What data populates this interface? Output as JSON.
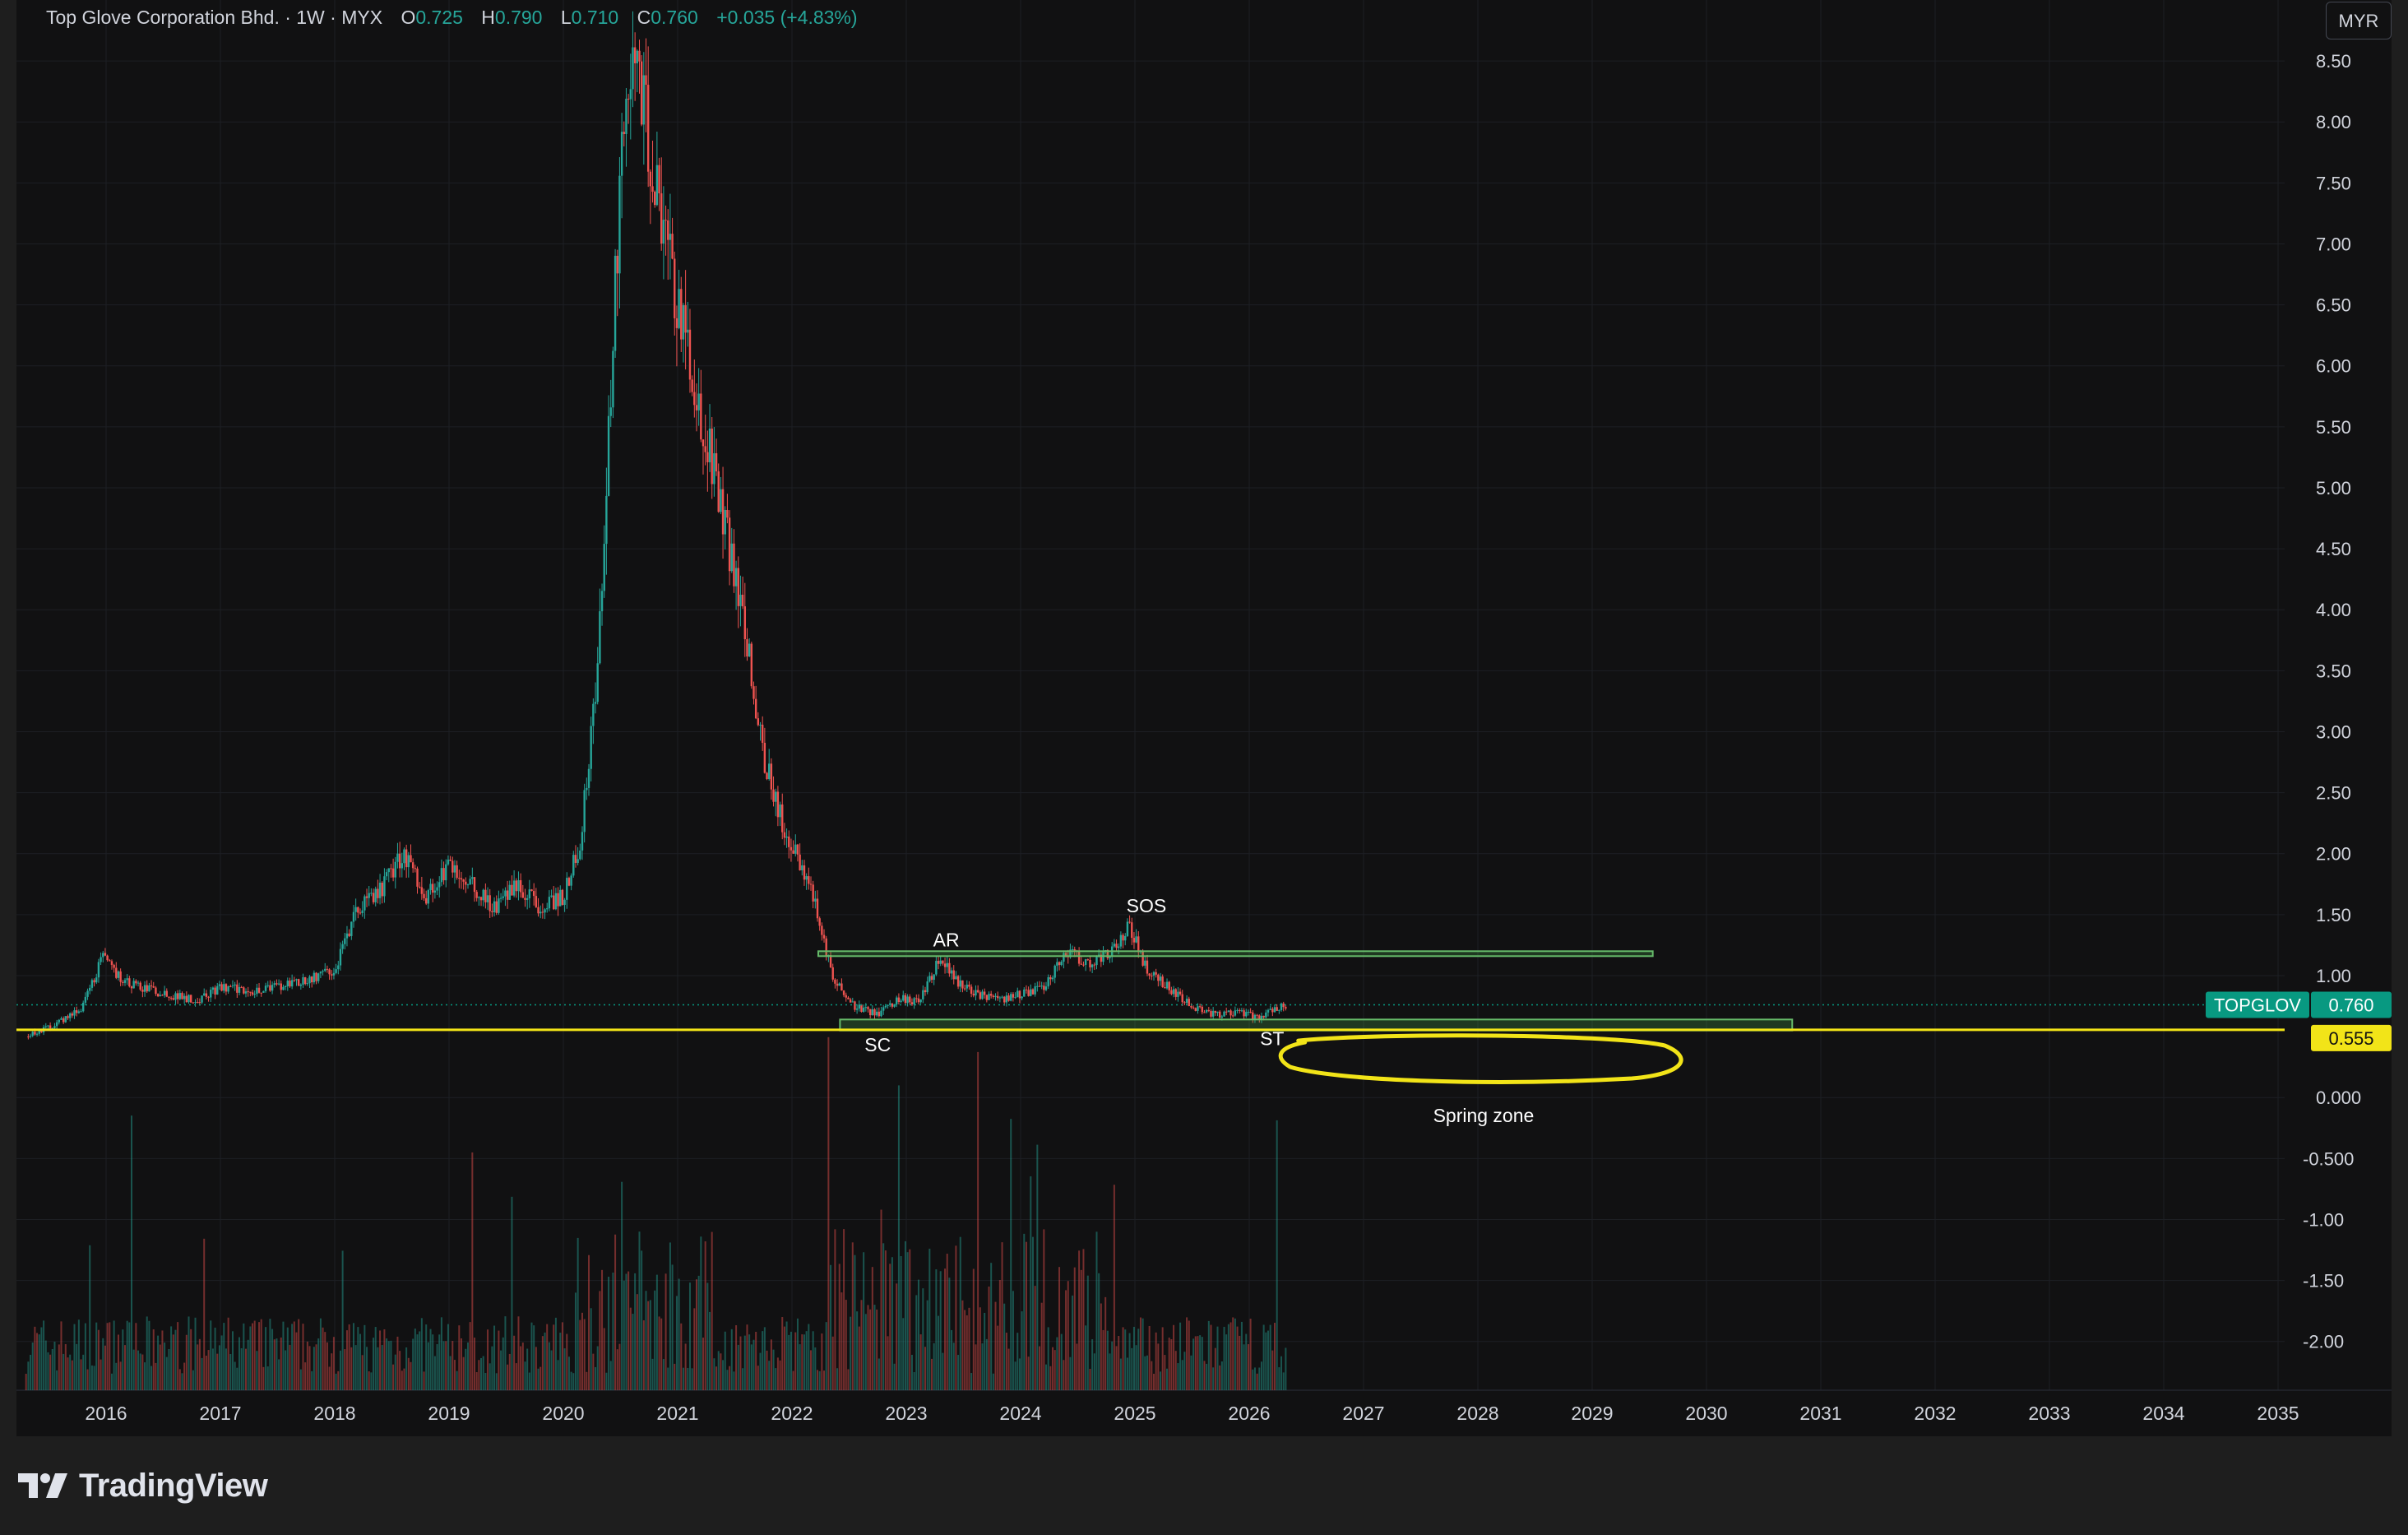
{
  "header": {
    "symbol_title": "Top Glove Corporation Bhd. · 1W · MYX",
    "o_label": "O",
    "o_value": "0.725",
    "h_label": "H",
    "h_value": "0.790",
    "l_label": "L",
    "l_value": "0.710",
    "c_label": "C",
    "c_value": "0.760",
    "change": "+0.035 (+4.83%)"
  },
  "currency_button": "MYR",
  "brand": {
    "name": "TradingView"
  },
  "price_tags": {
    "symbol_tag": "TOPGLOV",
    "symbol_value": "0.760",
    "line_value": "0.555",
    "symbol_color": "#089981",
    "line_color": "#f2e418"
  },
  "colors": {
    "up": "#26a69a",
    "down": "#ef5350",
    "level_line": "#f2e418",
    "zone_fill": "#4caf50",
    "background": "#111112"
  },
  "chart_data": {
    "type": "candlestick",
    "timeframe": "1W",
    "currency": "MYR",
    "x_ticks": [
      "2016",
      "2017",
      "2018",
      "2019",
      "2020",
      "2021",
      "2022",
      "2023",
      "2024",
      "2025",
      "2026",
      "2027",
      "2028",
      "2029",
      "2030",
      "2031",
      "2032",
      "2033",
      "2034",
      "2035"
    ],
    "y_ticks": [
      "8.50",
      "8.00",
      "7.50",
      "7.00",
      "6.50",
      "6.00",
      "5.50",
      "5.00",
      "4.50",
      "4.00",
      "3.50",
      "3.00",
      "2.50",
      "2.00",
      "1.50",
      "1.00",
      "0.000",
      "-0.500",
      "-1.00",
      "-1.50",
      "-2.00"
    ],
    "y_range": [
      -2.4,
      9.0
    ],
    "price_path": [
      {
        "t": 2015.3,
        "p": 0.5
      },
      {
        "t": 2015.6,
        "p": 0.62
      },
      {
        "t": 2015.8,
        "p": 0.75
      },
      {
        "t": 2015.97,
        "p": 1.15
      },
      {
        "t": 2016.15,
        "p": 0.95
      },
      {
        "t": 2016.5,
        "p": 0.85
      },
      {
        "t": 2016.8,
        "p": 0.8
      },
      {
        "t": 2017.0,
        "p": 0.9
      },
      {
        "t": 2017.3,
        "p": 0.88
      },
      {
        "t": 2017.7,
        "p": 0.95
      },
      {
        "t": 2018.0,
        "p": 1.05
      },
      {
        "t": 2018.2,
        "p": 1.55
      },
      {
        "t": 2018.4,
        "p": 1.7
      },
      {
        "t": 2018.6,
        "p": 2.0
      },
      {
        "t": 2018.8,
        "p": 1.65
      },
      {
        "t": 2019.0,
        "p": 1.9
      },
      {
        "t": 2019.2,
        "p": 1.75
      },
      {
        "t": 2019.4,
        "p": 1.55
      },
      {
        "t": 2019.6,
        "p": 1.75
      },
      {
        "t": 2019.8,
        "p": 1.55
      },
      {
        "t": 2020.0,
        "p": 1.65
      },
      {
        "t": 2020.15,
        "p": 2.1
      },
      {
        "t": 2020.3,
        "p": 3.5
      },
      {
        "t": 2020.42,
        "p": 6.0
      },
      {
        "t": 2020.55,
        "p": 8.5
      },
      {
        "t": 2020.7,
        "p": 8.2
      },
      {
        "t": 2020.85,
        "p": 7.2
      },
      {
        "t": 2021.0,
        "p": 6.5
      },
      {
        "t": 2021.15,
        "p": 5.8
      },
      {
        "t": 2021.3,
        "p": 5.2
      },
      {
        "t": 2021.45,
        "p": 4.5
      },
      {
        "t": 2021.6,
        "p": 3.8
      },
      {
        "t": 2021.75,
        "p": 2.8
      },
      {
        "t": 2021.9,
        "p": 2.3
      },
      {
        "t": 2022.05,
        "p": 1.95
      },
      {
        "t": 2022.2,
        "p": 1.6
      },
      {
        "t": 2022.35,
        "p": 1.0
      },
      {
        "t": 2022.55,
        "p": 0.75
      },
      {
        "t": 2022.75,
        "p": 0.68
      },
      {
        "t": 2022.95,
        "p": 0.82
      },
      {
        "t": 2023.1,
        "p": 0.78
      },
      {
        "t": 2023.3,
        "p": 1.15
      },
      {
        "t": 2023.45,
        "p": 0.95
      },
      {
        "t": 2023.6,
        "p": 0.85
      },
      {
        "t": 2023.8,
        "p": 0.8
      },
      {
        "t": 2024.0,
        "p": 0.85
      },
      {
        "t": 2024.2,
        "p": 0.9
      },
      {
        "t": 2024.4,
        "p": 1.2
      },
      {
        "t": 2024.6,
        "p": 1.1
      },
      {
        "t": 2024.8,
        "p": 1.2
      },
      {
        "t": 2024.95,
        "p": 1.42
      },
      {
        "t": 2025.1,
        "p": 1.05
      },
      {
        "t": 2025.3,
        "p": 0.9
      },
      {
        "t": 2025.5,
        "p": 0.75
      },
      {
        "t": 2025.7,
        "p": 0.68
      },
      {
        "t": 2025.9,
        "p": 0.7
      },
      {
        "t": 2026.1,
        "p": 0.65
      },
      {
        "t": 2026.2,
        "p": 0.72
      },
      {
        "t": 2026.3,
        "p": 0.76
      }
    ],
    "levels": [
      {
        "name": "horizontal-line",
        "price": 0.555,
        "t0": 2015.0,
        "t1": 2036.0
      }
    ],
    "zones": [
      {
        "name": "upper-range",
        "t0": 2022.23,
        "t1": 2029.53,
        "p0": 1.17,
        "p1": 1.2
      },
      {
        "name": "lower-range",
        "t0": 2022.42,
        "t1": 2030.75,
        "p0": 0.55,
        "p1": 0.64
      }
    ],
    "annotations": [
      {
        "text": "SC",
        "t": 2022.75,
        "p": 0.38
      },
      {
        "text": "AR",
        "t": 2023.35,
        "p": 1.24
      },
      {
        "text": "SOS",
        "t": 2025.1,
        "p": 1.52
      },
      {
        "text": "ST",
        "t": 2026.2,
        "p": 0.43
      },
      {
        "text": "Spring zone",
        "t": 2028.05,
        "p": -0.2
      }
    ],
    "spring_ellipse": {
      "t0": 2026.3,
      "t1": 2029.78,
      "p_top": 0.48,
      "p_bottom": 0.17
    }
  }
}
